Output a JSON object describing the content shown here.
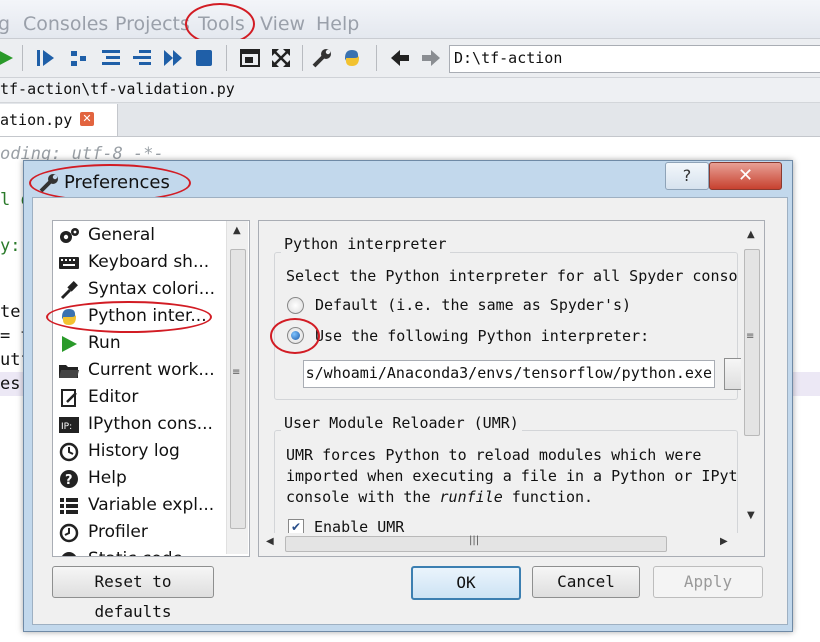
{
  "menubar": {
    "items": [
      "g",
      "Consoles",
      "Projects",
      "Tools",
      "View",
      "Help"
    ]
  },
  "toolbar": {
    "path": "D:\\tf-action",
    "icons": [
      "run-icon",
      "run-selection-icon",
      "step-icon",
      "step-into-icon",
      "step-return-icon",
      "continue-icon",
      "stop-icon",
      "maximize-pane-icon",
      "fullscreen-icon",
      "wrench-icon",
      "python-icon",
      "back-arrow-icon",
      "forward-arrow-icon"
    ]
  },
  "editor": {
    "file_path": "tf-action\\tf-validation.py",
    "tab_label": "ation.py",
    "code_lines": [
      "oding: utf-8 -*-",
      "l o",
      "y:",
      "te",
      "= t",
      "utf",
      "es"
    ]
  },
  "dialog": {
    "title": "Preferences",
    "help_label": "?",
    "close_label": "✕",
    "categories": [
      {
        "label": "General",
        "icon": "gears-icon"
      },
      {
        "label": "Keyboard sh...",
        "icon": "keyboard-icon"
      },
      {
        "label": "Syntax colori...",
        "icon": "eyedropper-icon"
      },
      {
        "label": "Python inter...",
        "icon": "python-icon"
      },
      {
        "label": "Run",
        "icon": "run-icon"
      },
      {
        "label": "Current work...",
        "icon": "folder-icon"
      },
      {
        "label": "Editor",
        "icon": "editor-icon"
      },
      {
        "label": "IPython cons...",
        "icon": "ipython-icon"
      },
      {
        "label": "History log",
        "icon": "history-icon"
      },
      {
        "label": "Help",
        "icon": "help-icon"
      },
      {
        "label": "Variable expl...",
        "icon": "variable-explorer-icon"
      },
      {
        "label": "Profiler",
        "icon": "profiler-icon"
      },
      {
        "label": "Static code...",
        "icon": "static-analysis-icon"
      }
    ],
    "selected_category": "Python inter...",
    "panel": {
      "interpreter_group_title": "Python interpreter",
      "interpreter_desc": "Select the Python interpreter for all Spyder conso",
      "option_default": "Default (i.e. the same as Spyder's)",
      "option_custom": "Use the following Python interpreter:",
      "selected_option": "custom",
      "interpreter_path": "s/whoami/Anaconda3/envs/tensorflow/python.exe",
      "umr_group_title": "User Module Reloader (UMR)",
      "umr_desc_line1": "UMR forces Python to reload modules which were",
      "umr_desc_line2": "imported when executing a file in a Python or IPyt",
      "umr_desc_line3_prefix": "console with the ",
      "umr_desc_line3_em": "runfile",
      "umr_desc_line3_suffix": " function.",
      "enable_umr_label": "Enable UMR",
      "enable_umr_checked": true
    },
    "buttons": {
      "reset": "Reset to defaults",
      "ok": "OK",
      "cancel": "Cancel",
      "apply": "Apply"
    }
  },
  "colors": {
    "annotation": "#d21c24",
    "dialog_frame": "#c2d8ec",
    "close_button": "#c7412f",
    "ok_focus": "#3c7fb1"
  }
}
